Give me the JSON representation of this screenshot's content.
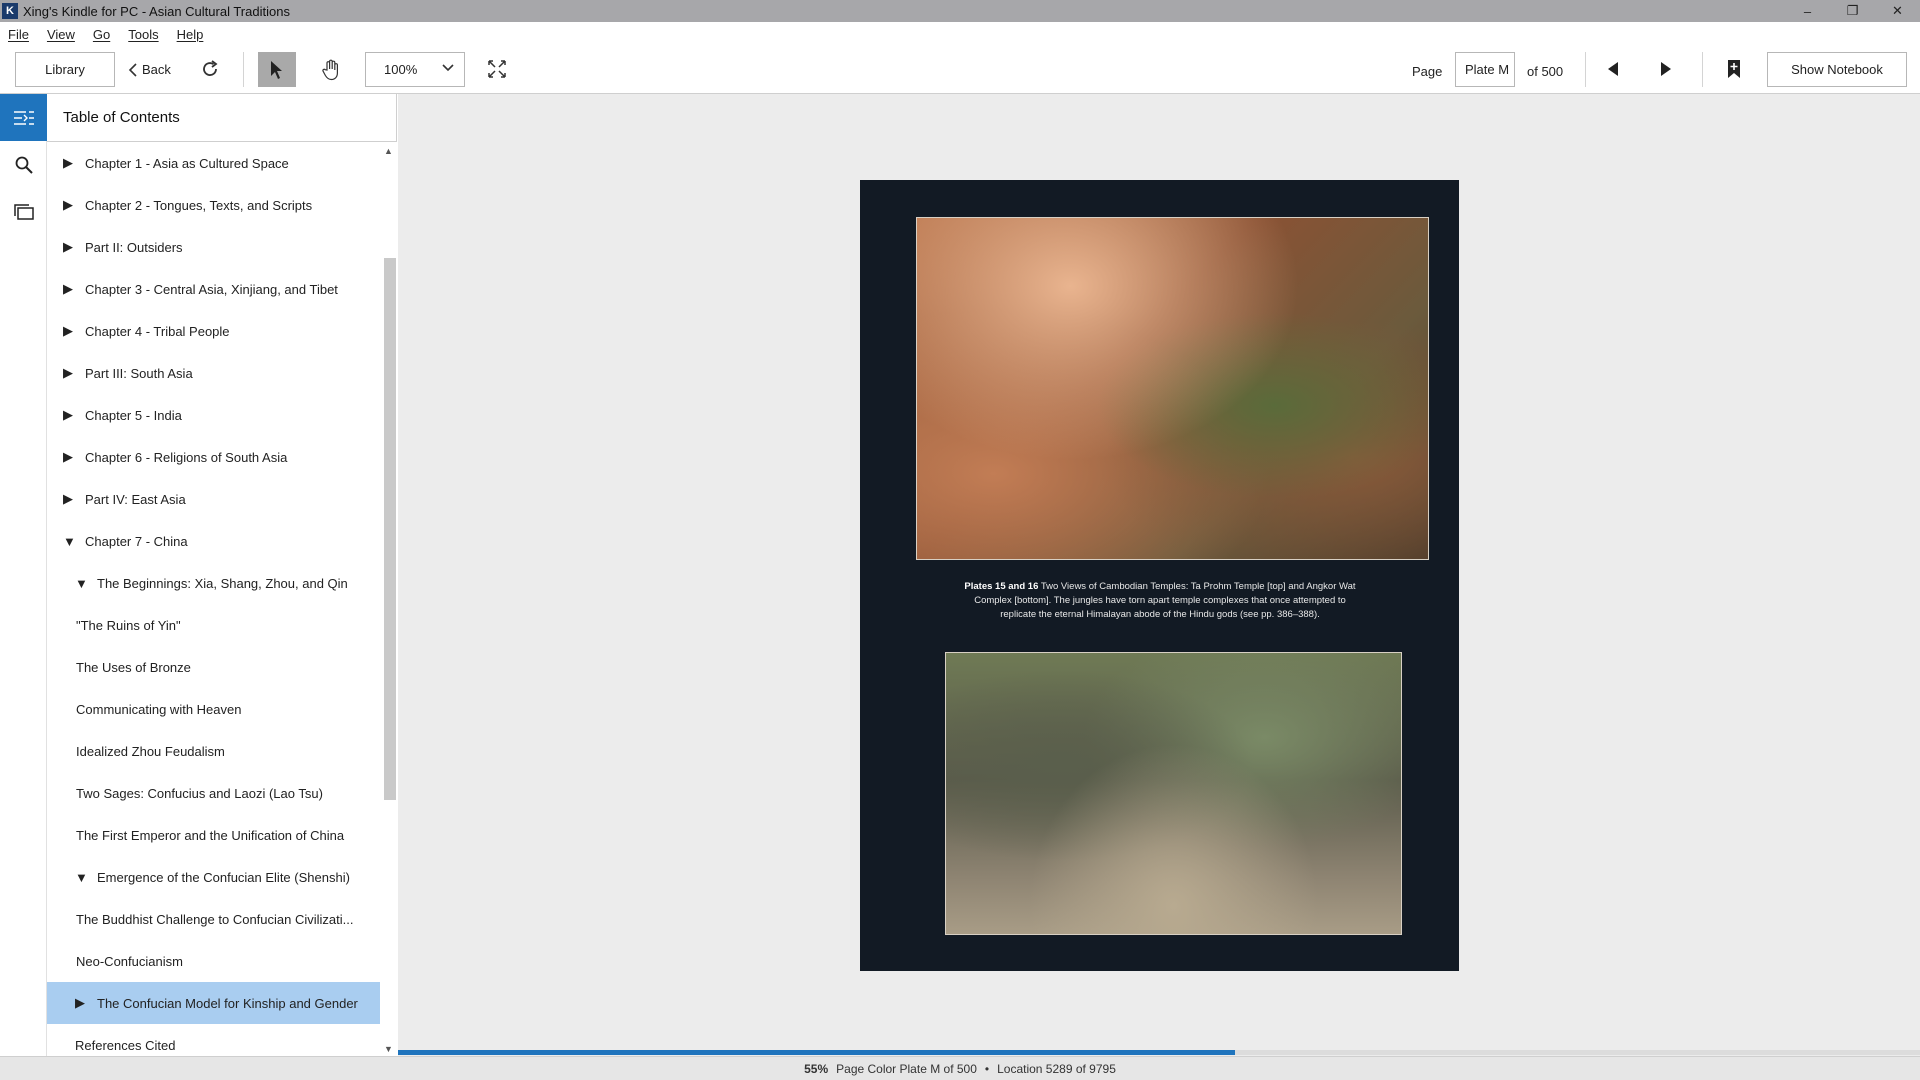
{
  "window": {
    "title": "Xing's Kindle for PC - Asian Cultural Traditions",
    "app_icon_letter": "K",
    "controls": {
      "minimize": "–",
      "restore": "❐",
      "close": "✕"
    }
  },
  "menu": [
    "File",
    "View",
    "Go",
    "Tools",
    "Help"
  ],
  "toolbar": {
    "library_label": "Library",
    "back_label": "Back",
    "zoom_value": "100%",
    "page_label": "Page",
    "page_value": "Plate M",
    "page_of": "of 500",
    "notebook_label": "Show Notebook"
  },
  "rail": {
    "icons": [
      "toc-icon",
      "search-icon",
      "flashcards-icon"
    ]
  },
  "toc": {
    "title": "Table of Contents",
    "items": [
      {
        "label": "Chapter 1 - Asia as Cultured Space",
        "state": "collapsed"
      },
      {
        "label": "Chapter 2 - Tongues, Texts, and Scripts",
        "state": "collapsed"
      },
      {
        "label": "Part II: Outsiders",
        "state": "collapsed"
      },
      {
        "label": "Chapter 3 - Central Asia, Xinjiang, and Tibet",
        "state": "collapsed"
      },
      {
        "label": "Chapter 4 - Tribal People",
        "state": "collapsed"
      },
      {
        "label": "Part III: South Asia",
        "state": "collapsed"
      },
      {
        "label": "Chapter 5 - India",
        "state": "collapsed"
      },
      {
        "label": "Chapter 6 - Religions of South Asia",
        "state": "collapsed"
      },
      {
        "label": "Part IV: East Asia",
        "state": "collapsed"
      },
      {
        "label": "Chapter 7 - China",
        "state": "expanded"
      },
      {
        "label": "The Beginnings: Xia, Shang, Zhou, and Qin",
        "state": "expanded"
      },
      {
        "label": "\"The Ruins of Yin\"",
        "state": "leaf"
      },
      {
        "label": "The Uses of Bronze",
        "state": "leaf"
      },
      {
        "label": "Communicating with Heaven",
        "state": "leaf"
      },
      {
        "label": "Idealized Zhou Feudalism",
        "state": "leaf"
      },
      {
        "label": "Two Sages: Confucius and Laozi (Lao Tsu)",
        "state": "leaf"
      },
      {
        "label": "The First Emperor and the Unification of China",
        "state": "leaf"
      },
      {
        "label": "Emergence of the Confucian Elite (Shenshi)",
        "state": "expanded"
      },
      {
        "label": "The Buddhist Challenge to Confucian Civilizati...",
        "state": "leaf"
      },
      {
        "label": "Neo-Confucianism",
        "state": "leaf"
      },
      {
        "label": "The Confucian Model for Kinship and Gender",
        "state": "collapsed-selected"
      },
      {
        "label": "References Cited",
        "state": "leaf"
      }
    ]
  },
  "page": {
    "caption_bold": "Plates 15 and 16",
    "caption_text": "Two Views of Cambodian Temples: Ta Prohm Temple [top] and Angkor Wat Complex [bottom]. The jungles have torn apart temple complexes that once attempted to replicate the eternal Himalayan abode of the Hindu gods (see pp. 386–388).",
    "image_top": "Ta Prohm Temple",
    "image_bottom": "Angkor Wat Complex"
  },
  "progress_fraction": 0.55,
  "status": {
    "percent": "55%",
    "page_color": "Page Color Plate M of 500",
    "bullet": "•",
    "location": "Location 5289 of 9795"
  },
  "colors": {
    "accent": "#1f74bd",
    "selected": "#a9cdf0",
    "page_bg": "#121a24"
  }
}
